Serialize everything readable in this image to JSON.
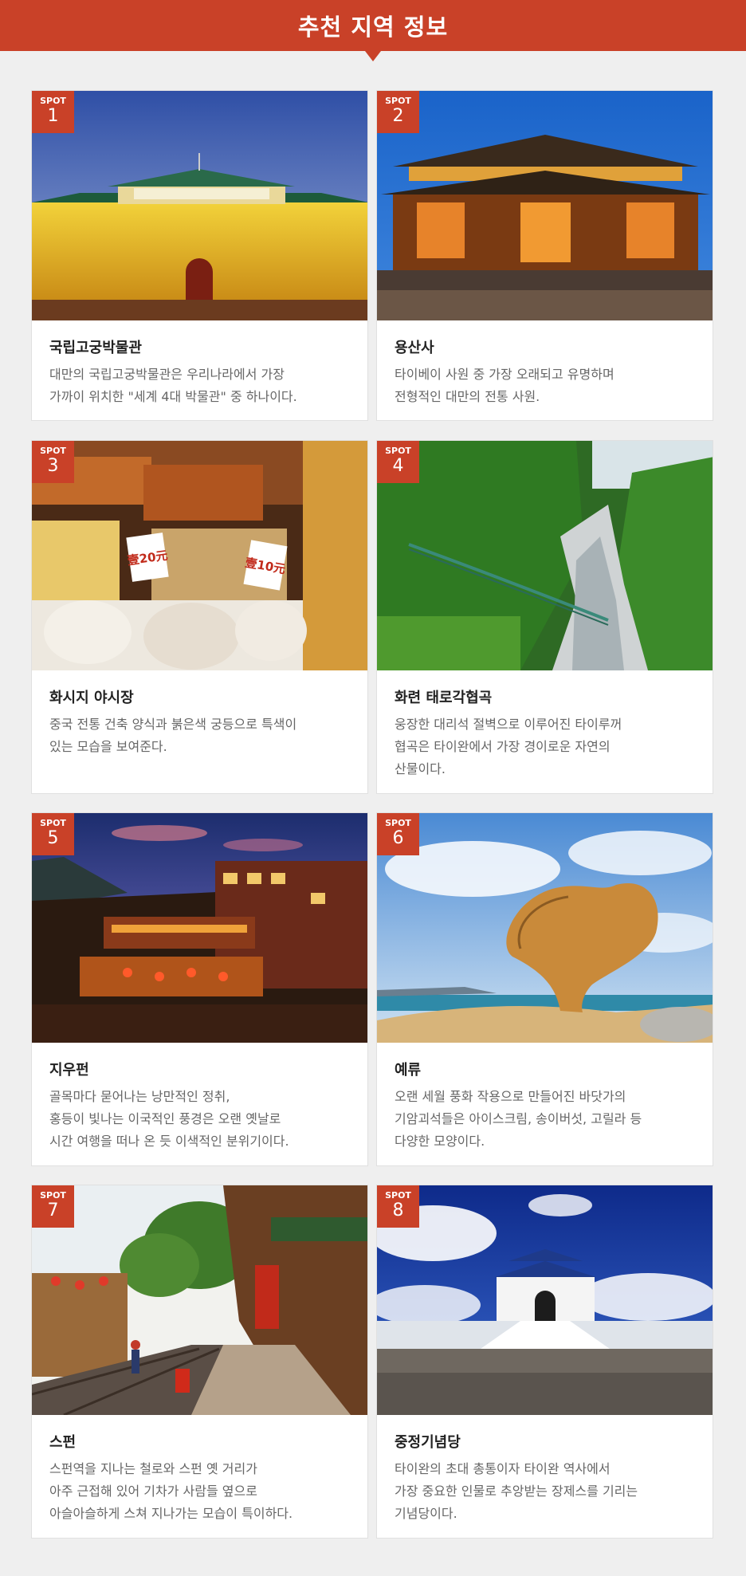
{
  "header": {
    "title": "추천 지역 정보"
  },
  "spot_label": "SPOT",
  "spots": [
    {
      "number": "1",
      "title": "국립고궁박물관",
      "lines": [
        "대만의 국립고궁박물관은 우리나라에서 가장",
        "가까이 위치한 \"세계 4대 박물관\" 중 하나이다."
      ],
      "scene": "museum at dusk"
    },
    {
      "number": "2",
      "title": "용산사",
      "lines": [
        "타이베이 사원 중 가장 오래되고 유명하며",
        "전형적인 대만의 전통 사원."
      ],
      "scene": "lit temple"
    },
    {
      "number": "3",
      "title": "화시지 야시장",
      "lines": [
        "중국 전통 건축 양식과 붉은색 궁등으로 특색이",
        "있는 모습을 보여준다."
      ],
      "scene": "dried seafood market",
      "price_tags": [
        "壹20元",
        "壹10元"
      ]
    },
    {
      "number": "4",
      "title": "화련 태로각협곡",
      "lines": [
        "웅장한 대리석 절벽으로 이루어진 타이루꺼",
        "협곡은 타이완에서 가장 경이로운 자연의",
        "산물이다."
      ],
      "scene": "gorge with bridge"
    },
    {
      "number": "5",
      "title": "지우펀",
      "lines": [
        "골목마다 묻어나는 낭만적인 정취,",
        "홍등이 빛나는 이국적인 풍경은 오랜 옛날로",
        "시간 여행을 떠나 온 듯 이색적인 분위기이다."
      ],
      "scene": "hillside town at dusk"
    },
    {
      "number": "6",
      "title": "예류",
      "lines": [
        "오랜 세월 풍화 작용으로 만들어진 바닷가의",
        "기암괴석들은 아이스크림, 송이버섯, 고릴라 등",
        "다양한 모양이다."
      ],
      "scene": "queen's head rock"
    },
    {
      "number": "7",
      "title": "스펀",
      "lines": [
        "스펀역을 지나는 철로와 스펀 옛 거리가",
        "아주 근접해 있어 기차가 사람들 옆으로",
        "아슬아슬하게 스쳐 지나가는 모습이 특이하다."
      ],
      "scene": "old street with railway"
    },
    {
      "number": "8",
      "title": "중정기념당",
      "lines": [
        "타이완의 초대 총통이자 타이완 역사에서",
        "가장 중요한 인물로 추앙받는 장제스를 기리는",
        "기념당이다."
      ],
      "scene": "memorial hall"
    }
  ],
  "colors": {
    "accent": "#c94128",
    "background": "#efefef",
    "card": "#ffffff",
    "title": "#222222",
    "text": "#666666"
  }
}
